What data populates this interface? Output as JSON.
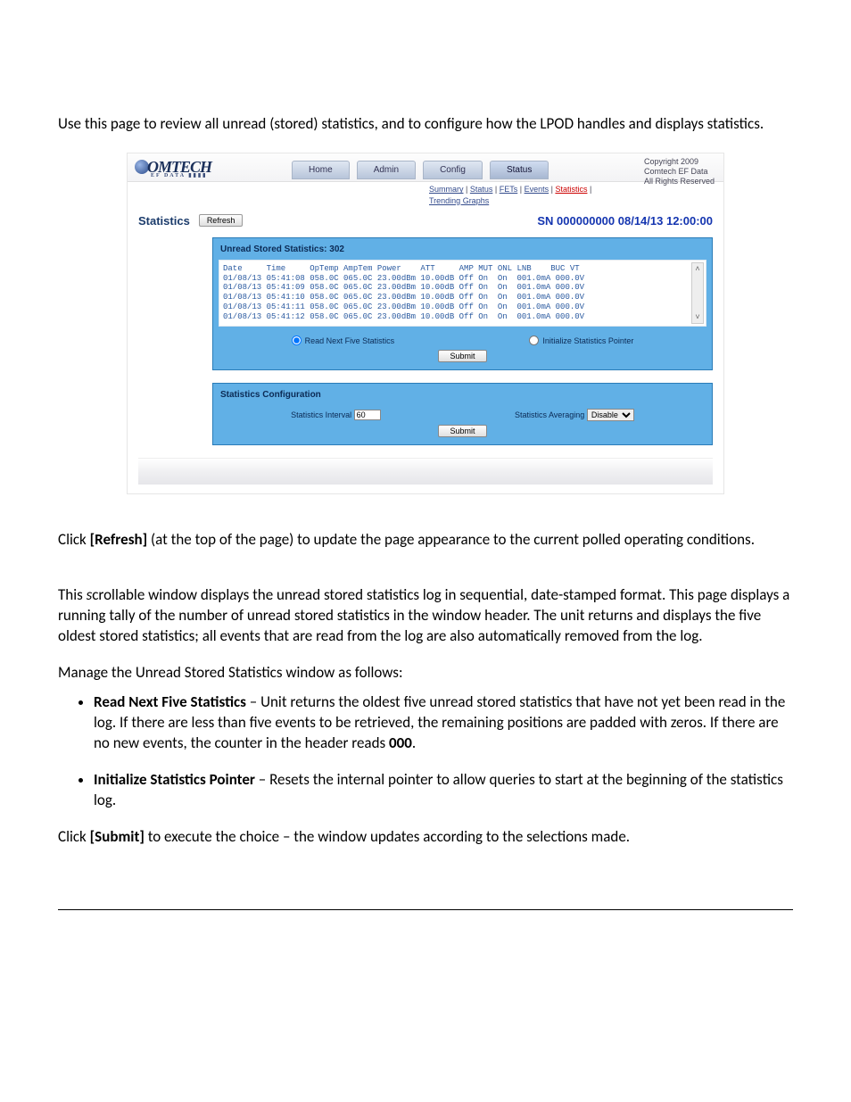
{
  "intro_text": "Use this page to review all unread (stored) statistics, and to configure how the LPOD handles and displays statistics.",
  "shot": {
    "logo_main": "OMTECH",
    "logo_sub": "EF DATA ▮▮▮▮",
    "tabs": [
      "Home",
      "Admin",
      "Config",
      "Status"
    ],
    "copyright": "Copyright 2009\nComtech EF Data\nAll Rights Reserved",
    "subnav_items": [
      "Summary",
      "Status",
      "FETs",
      "Events"
    ],
    "subnav_current": "Statistics",
    "subnav_line2": "Trending Graphs",
    "pagetitle": "Statistics",
    "refresh_label": "Refresh",
    "snline": "SN 000000000 08/14/13 12:00:00",
    "unread_header": "Unread Stored Statistics: 302",
    "table_header": "Date     Time     OpTemp AmpTem Power    ATT     AMP MUT ONL LNB    BUC VT",
    "rows": [
      "01/08/13 05:41:08 058.0C 065.0C 23.00dBm 10.00dB Off On  On  001.0mA 000.0V",
      "01/08/13 05:41:09 058.0C 065.0C 23.00dBm 10.00dB Off On  On  001.0mA 000.0V",
      "01/08/13 05:41:10 058.0C 065.0C 23.00dBm 10.00dB Off On  On  001.0mA 000.0V",
      "01/08/13 05:41:11 058.0C 065.0C 23.00dBm 10.00dB Off On  On  001.0mA 000.0V",
      "01/08/13 05:41:12 058.0C 065.0C 23.00dBm 10.00dB Off On  On  001.0mA 000.0V"
    ],
    "radio_read": "Read Next Five Statistics",
    "radio_init": "Initialize Statistics Pointer",
    "submit_label": "Submit",
    "cfg_header": "Statistics Configuration",
    "cfg_interval_label": "Statistics Interval",
    "cfg_interval_value": "60",
    "cfg_avg_label": "Statistics Averaging",
    "cfg_avg_value": "Disable"
  },
  "body_paragraphs": {
    "p1_a": "Click ",
    "p1_b": "[Refresh]",
    "p1_c": " (at the top of the page) to update the page appearance to the current polled operating conditions.",
    "p2_a": "This ",
    "p2_ital": "s",
    "p2_b": "crollable window displays the unread stored statistics log in sequential, date-stamped format. This page displays a running tally of the number of unread stored statistics in the window header. The unit returns and displays the five oldest stored statistics; all events that are read from the log are also automatically removed from the log.",
    "p3": "Manage the Unread Stored Statistics window as follows:",
    "b1_label": "Read Next Five Statistics",
    "b1_text": " – Unit returns the oldest five unread stored statistics that have not yet been read in the log. If there are less than five events to be retrieved, the remaining positions are padded with zeros. If there are no new events, the counter in the header reads ",
    "b1_end": "000",
    "b1_dot": ".",
    "b2_label": "Initialize Statistics Pointer",
    "b2_text": " – Resets the internal pointer to allow queries to start at the beginning of the statistics log.",
    "p4_a": "Click ",
    "p4_b": "[Submit]",
    "p4_c": " to execute the choice – the window updates according to the selections made."
  }
}
